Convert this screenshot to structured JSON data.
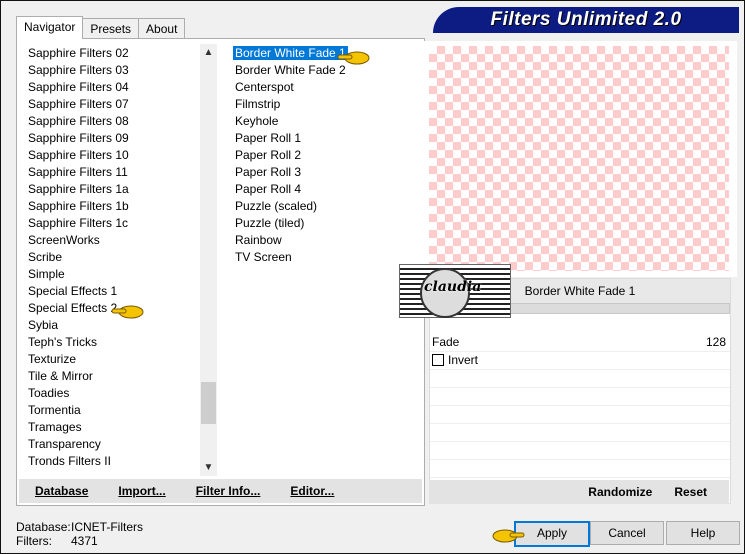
{
  "title": "Filters Unlimited 2.0",
  "tabs": [
    {
      "label": "Navigator"
    },
    {
      "label": "Presets"
    },
    {
      "label": "About"
    }
  ],
  "categories": [
    "Sapphire Filters 02",
    "Sapphire Filters 03",
    "Sapphire Filters 04",
    "Sapphire Filters 07",
    "Sapphire Filters 08",
    "Sapphire Filters 09",
    "Sapphire Filters 10",
    "Sapphire Filters 11",
    "Sapphire Filters 1a",
    "Sapphire Filters 1b",
    "Sapphire Filters 1c",
    "ScreenWorks",
    "Scribe",
    "Simple",
    "Special Effects 1",
    "Special Effects 2",
    "Sybia",
    "Teph's Tricks",
    "Texturize",
    "Tile & Mirror",
    "Toadies",
    "Tormentia",
    "Tramages",
    "Transparency",
    "Tronds Filters II"
  ],
  "filters": [
    "Border White Fade 1",
    "Border White Fade 2",
    "Centerspot",
    "Filmstrip",
    "Keyhole",
    "Paper Roll 1",
    "Paper Roll 2",
    "Paper Roll 3",
    "Paper Roll 4",
    "Puzzle (scaled)",
    "Puzzle (tiled)",
    "Rainbow",
    "TV Screen"
  ],
  "left_buttons": {
    "database": "Database",
    "import": "Import...",
    "filter_info": "Filter Info...",
    "editor": "Editor..."
  },
  "settings": {
    "filter_name": "Border White Fade 1",
    "fade_label": "Fade",
    "fade_value": "128",
    "invert_label": "Invert"
  },
  "right_buttons": {
    "randomize": "Randomize",
    "reset": "Reset"
  },
  "status": {
    "database_label": "Database:",
    "database_value": "ICNET-Filters",
    "filters_label": "Filters:",
    "filters_value": "4371"
  },
  "bottom_buttons": {
    "apply": "Apply",
    "cancel": "Cancel",
    "help": "Help"
  },
  "logo_text": "claudia",
  "colors": {
    "banner": "#0c1c82",
    "selection": "#0078d7",
    "checker": "#ffcccc"
  }
}
